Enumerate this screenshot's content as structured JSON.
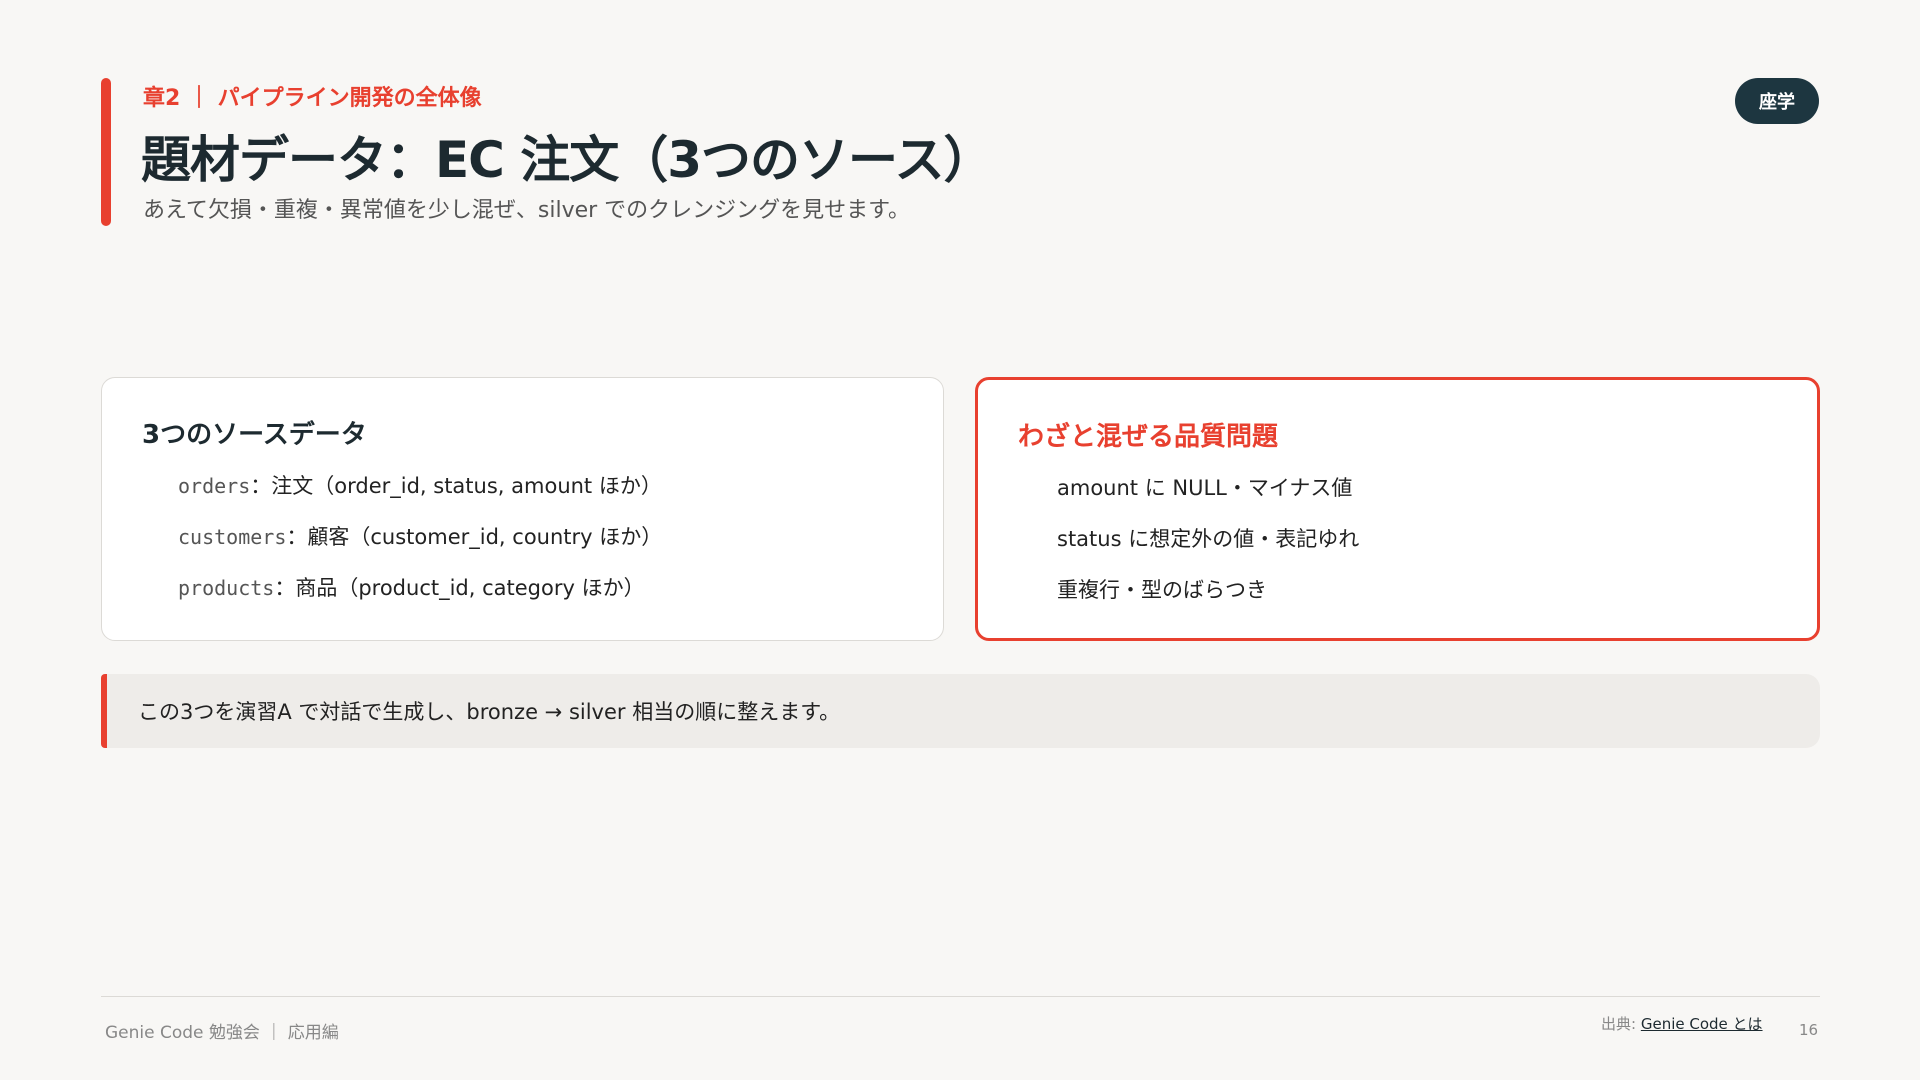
{
  "header": {
    "chapter": "章2 ｜ パイプライン開発の全体像",
    "title": "題材データ：EC 注文（3つのソース）",
    "subtitle": "あえて欠損・重複・異常値を少し混ぜ、silver でのクレンジングを見せます。",
    "badge": "座学"
  },
  "left_card": {
    "title": "3つのソースデータ",
    "items": [
      {
        "name": "orders",
        "desc": "：注文（order_id, status, amount ほか）"
      },
      {
        "name": "customers",
        "desc": "：顧客（customer_id, country ほか）"
      },
      {
        "name": "products",
        "desc": "：商品（product_id, category ほか）"
      }
    ]
  },
  "right_card": {
    "title": "わざと混ぜる品質問題",
    "items": [
      "amount に NULL・マイナス値",
      "status に想定外の値・表記ゆれ",
      "重複行・型のばらつき"
    ]
  },
  "note": "この3つを演習A で対話で生成し、bronze → silver 相当の順に整えます。",
  "footer": {
    "left": "Genie Code 勉強会 ｜ 応用編",
    "source_label": "出典:",
    "source_link": "Genie Code とは",
    "page": "16"
  },
  "colors": {
    "accent": "#e8402f",
    "dark": "#1d3640",
    "background": "#f8f7f5"
  }
}
